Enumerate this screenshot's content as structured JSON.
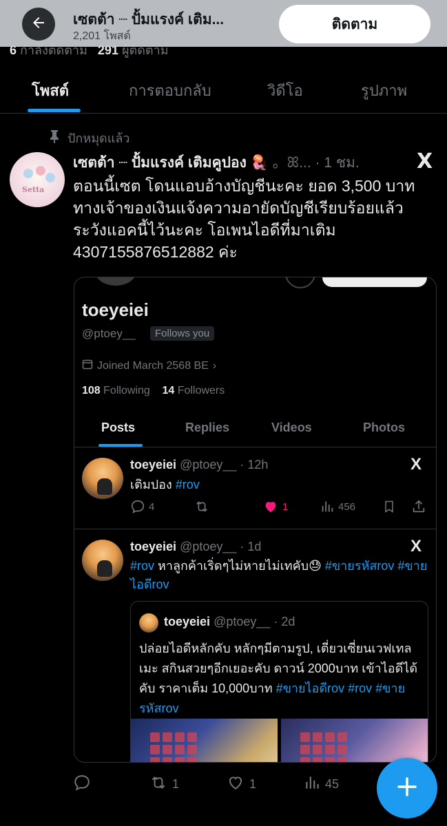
{
  "header": {
    "title": "เซตต้า ┈ ปั้มแรงค์ เติม...",
    "subtitle": "2,201 โพสต์",
    "follow_label": "ติดตาม",
    "peek_stats": {
      "following_count": "6",
      "following_label": "กำลังติดตาม",
      "followers_count": "291",
      "followers_label": "ผู้ติดตาม"
    }
  },
  "tabs": [
    "โพสต์",
    "การตอบกลับ",
    "วิดีโอ",
    "รูปภาพ"
  ],
  "pinned_label": "ปักหมุดแล้ว",
  "tweet": {
    "name": "เซตต้า ┈ ปั้มแรงค์ เติมคูปอง 🪼",
    "handle": "。ꕤ...",
    "time": "· 1 ชม.",
    "avatar_text": "Setta",
    "body": "ตอนนี้เซต โดนแอบอ้างบัญชีนะคะ ยอด 3,500 บาท ทางเจ้าของเงินแจ้งความอายัดบัญชีเรียบร้อยแล้ว ระวังแอคนี้ไว้นะคะ โอเพนไอดีที่มาเติม 4307155876512882 ค่ะ",
    "actions": {
      "reply": "",
      "repost": "1",
      "like": "1",
      "views": "45"
    }
  },
  "screenshot": {
    "name": "toeyeiei",
    "handle": "@ptoey__",
    "follows_you": "Follows you",
    "joined": "Joined March 2568 BE",
    "following_count": "108",
    "following_label": "Following",
    "followers_count": "14",
    "followers_label": "Followers",
    "tabs": [
      "Posts",
      "Replies",
      "Videos",
      "Photos"
    ],
    "posts": [
      {
        "name": "toeyeiei",
        "meta": "@ptoey__ · 12h",
        "text": "เติมปอง",
        "tag": "#rov",
        "replies": "4",
        "likes": "1",
        "views": "456"
      },
      {
        "name": "toeyeiei",
        "meta": "@ptoey__ · 1d",
        "tag1": "#rov",
        "text": " หาลูกค้าเริ่ดๆไม่หายไม่เทคับ😓 ",
        "tag2": "#ขายรหัสrov",
        "tag3": "#ขายไอดีrov"
      }
    ],
    "quote": {
      "name": "toeyeiei",
      "meta": "@ptoey__ · 2d",
      "text": "ปล่อยไอดีหลักคับ หลักๆมีตามรูป, เตี่ยวเซี่ยนเวฟเทลเมะ สกินสวยๆอีกเยอะคับ ดาวน์ 2000บาท เข้าไอดีได้คับ ราคาเต็ม 10,000บาท ",
      "tag1": "#ขายไอดีrov",
      "tag2": "#rov",
      "tag3": "#ขายรหัสrov"
    }
  },
  "colors": {
    "accent": "#1d9bf0",
    "like": "#f91880",
    "background": "#000000"
  },
  "icons": [
    "back-arrow-icon",
    "pin-icon",
    "x-logo-icon",
    "calendar-icon",
    "reply-icon",
    "repost-icon",
    "heart-icon",
    "views-icon",
    "bookmark-icon",
    "share-icon",
    "plus-icon"
  ]
}
